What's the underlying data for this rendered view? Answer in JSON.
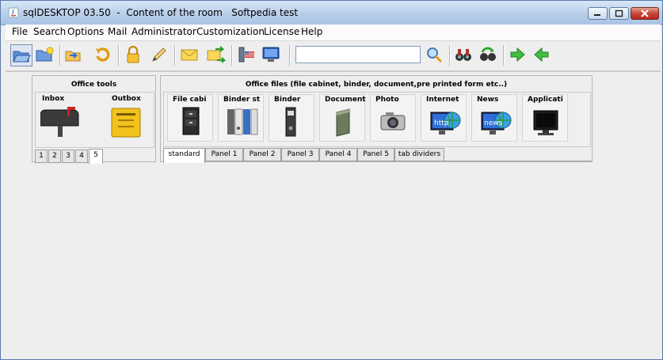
{
  "window": {
    "title": "sqlDESKTOP 03.50  -  Content of the room   Softpedia test"
  },
  "menubar": {
    "items": [
      "File",
      "Search",
      "Options",
      "Mail",
      "Administrator",
      "Customization",
      "License",
      "Help"
    ]
  },
  "toolbar": {
    "search": {
      "value": "",
      "placeholder": ""
    },
    "buttons": [
      "open-folder",
      "new-folder",
      "folder-arrow",
      "refresh",
      "lock",
      "pencil",
      "mail",
      "exchange",
      "flag-server",
      "monitor",
      "search",
      "binoculars",
      "refresh-green",
      "arrow-right",
      "arrow-left"
    ]
  },
  "office_tools": {
    "title": "Office tools",
    "items": [
      {
        "label": "Inbox",
        "icon": "mailbox-icon"
      },
      {
        "label": "Outbox",
        "icon": "outbox-icon"
      }
    ],
    "tabs": [
      "1",
      "2",
      "3",
      "4",
      "5"
    ],
    "active_tab": "5"
  },
  "office_files": {
    "title": "Office files (file cabinet, binder, document,pre printed form etc..)",
    "items": [
      {
        "label": "File cabi",
        "icon": "file-cabinet-icon"
      },
      {
        "label": "Binder st",
        "icon": "binder-stack-icon"
      },
      {
        "label": "Binder",
        "icon": "binder-icon"
      },
      {
        "label": "Document",
        "icon": "document-icon"
      },
      {
        "label": "Photo",
        "icon": "camera-icon"
      },
      {
        "label": "Internet",
        "icon": "internet-icon"
      },
      {
        "label": "News",
        "icon": "news-icon"
      },
      {
        "label": "Applicati",
        "icon": "application-monitor-icon"
      }
    ],
    "tabs": [
      "standard",
      "Panel 1",
      "Panel 2",
      "Panel 3",
      "Panel 4",
      "Panel 5",
      "tab dividers"
    ],
    "active_tab": "standard",
    "icon_text": {
      "internet": "http",
      "news": "news"
    }
  }
}
